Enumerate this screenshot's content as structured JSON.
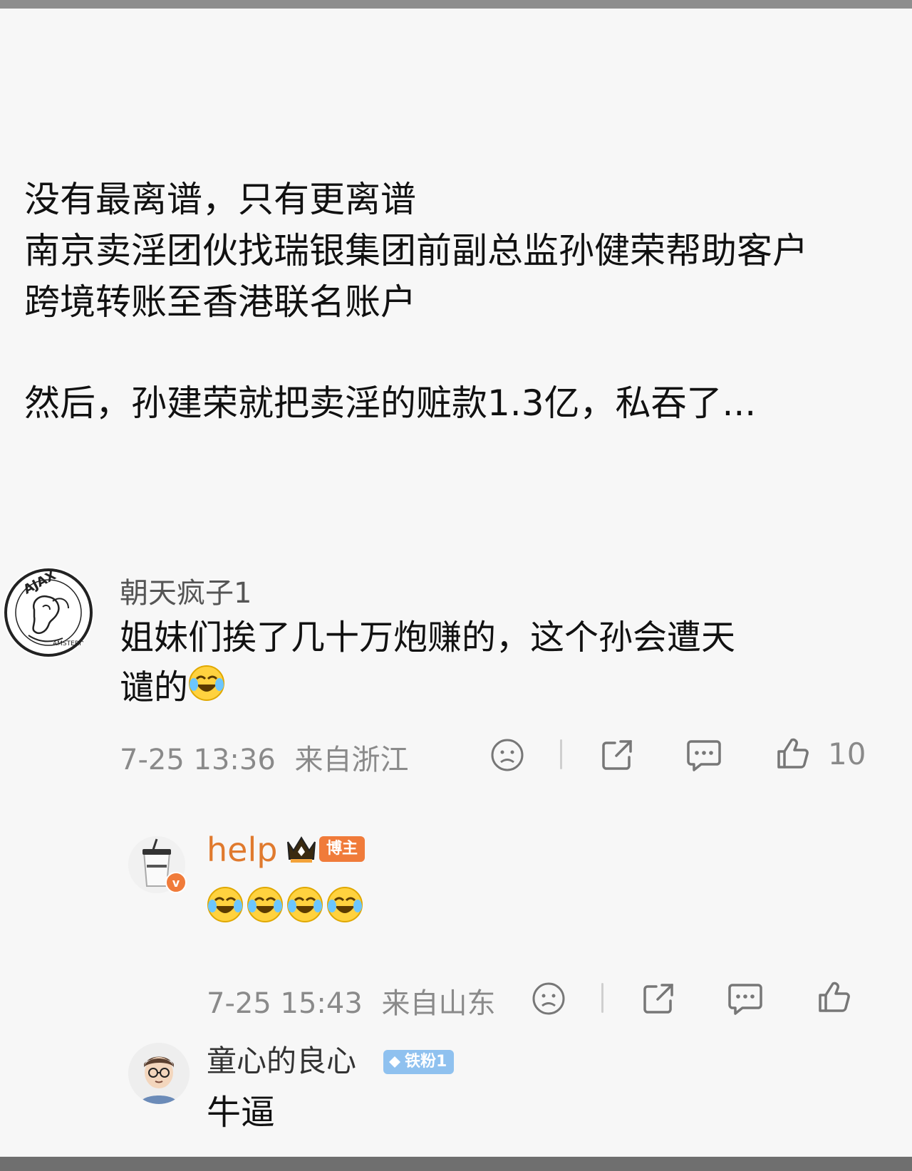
{
  "post": {
    "lines": [
      "没有最离谱，只有更离谱",
      "南京卖淫团伙找瑞银集团前副总监孙健荣帮助客户",
      "跨境转账至香港联名账户",
      "然后，孙建荣就把卖淫的赃款1.3亿，私吞了..."
    ]
  },
  "comments": [
    {
      "username": "朝天疯子1",
      "text_line1": "姐妹们挨了几十万炮赚的，这个孙会遭天",
      "text_line2": "谴的",
      "emoji": "laugh-cry-emoji",
      "time": "7-25 13:36",
      "location": "来自浙江",
      "likes": "10",
      "avatar": "ajax-logo-avatar"
    },
    {
      "username": "help",
      "badge": "博主",
      "emoji_count": 4,
      "emoji": "laugh-cry-emoji",
      "time": "7-25 15:43",
      "location": "来自山东",
      "avatar": "coffee-cup-avatar"
    },
    {
      "username": "童心的良心",
      "badge": "铁粉1",
      "text": "牛逼",
      "avatar": "cartoon-man-avatar"
    }
  ],
  "colors": {
    "host_name": "#e07a2e",
    "meta_gray": "#8a8a8a",
    "host_badge": "#f07b3a",
    "fan_badge": "#8fc1ef"
  },
  "icons": [
    "dislike-face-icon",
    "share-icon",
    "comment-icon",
    "like-thumb-icon"
  ]
}
